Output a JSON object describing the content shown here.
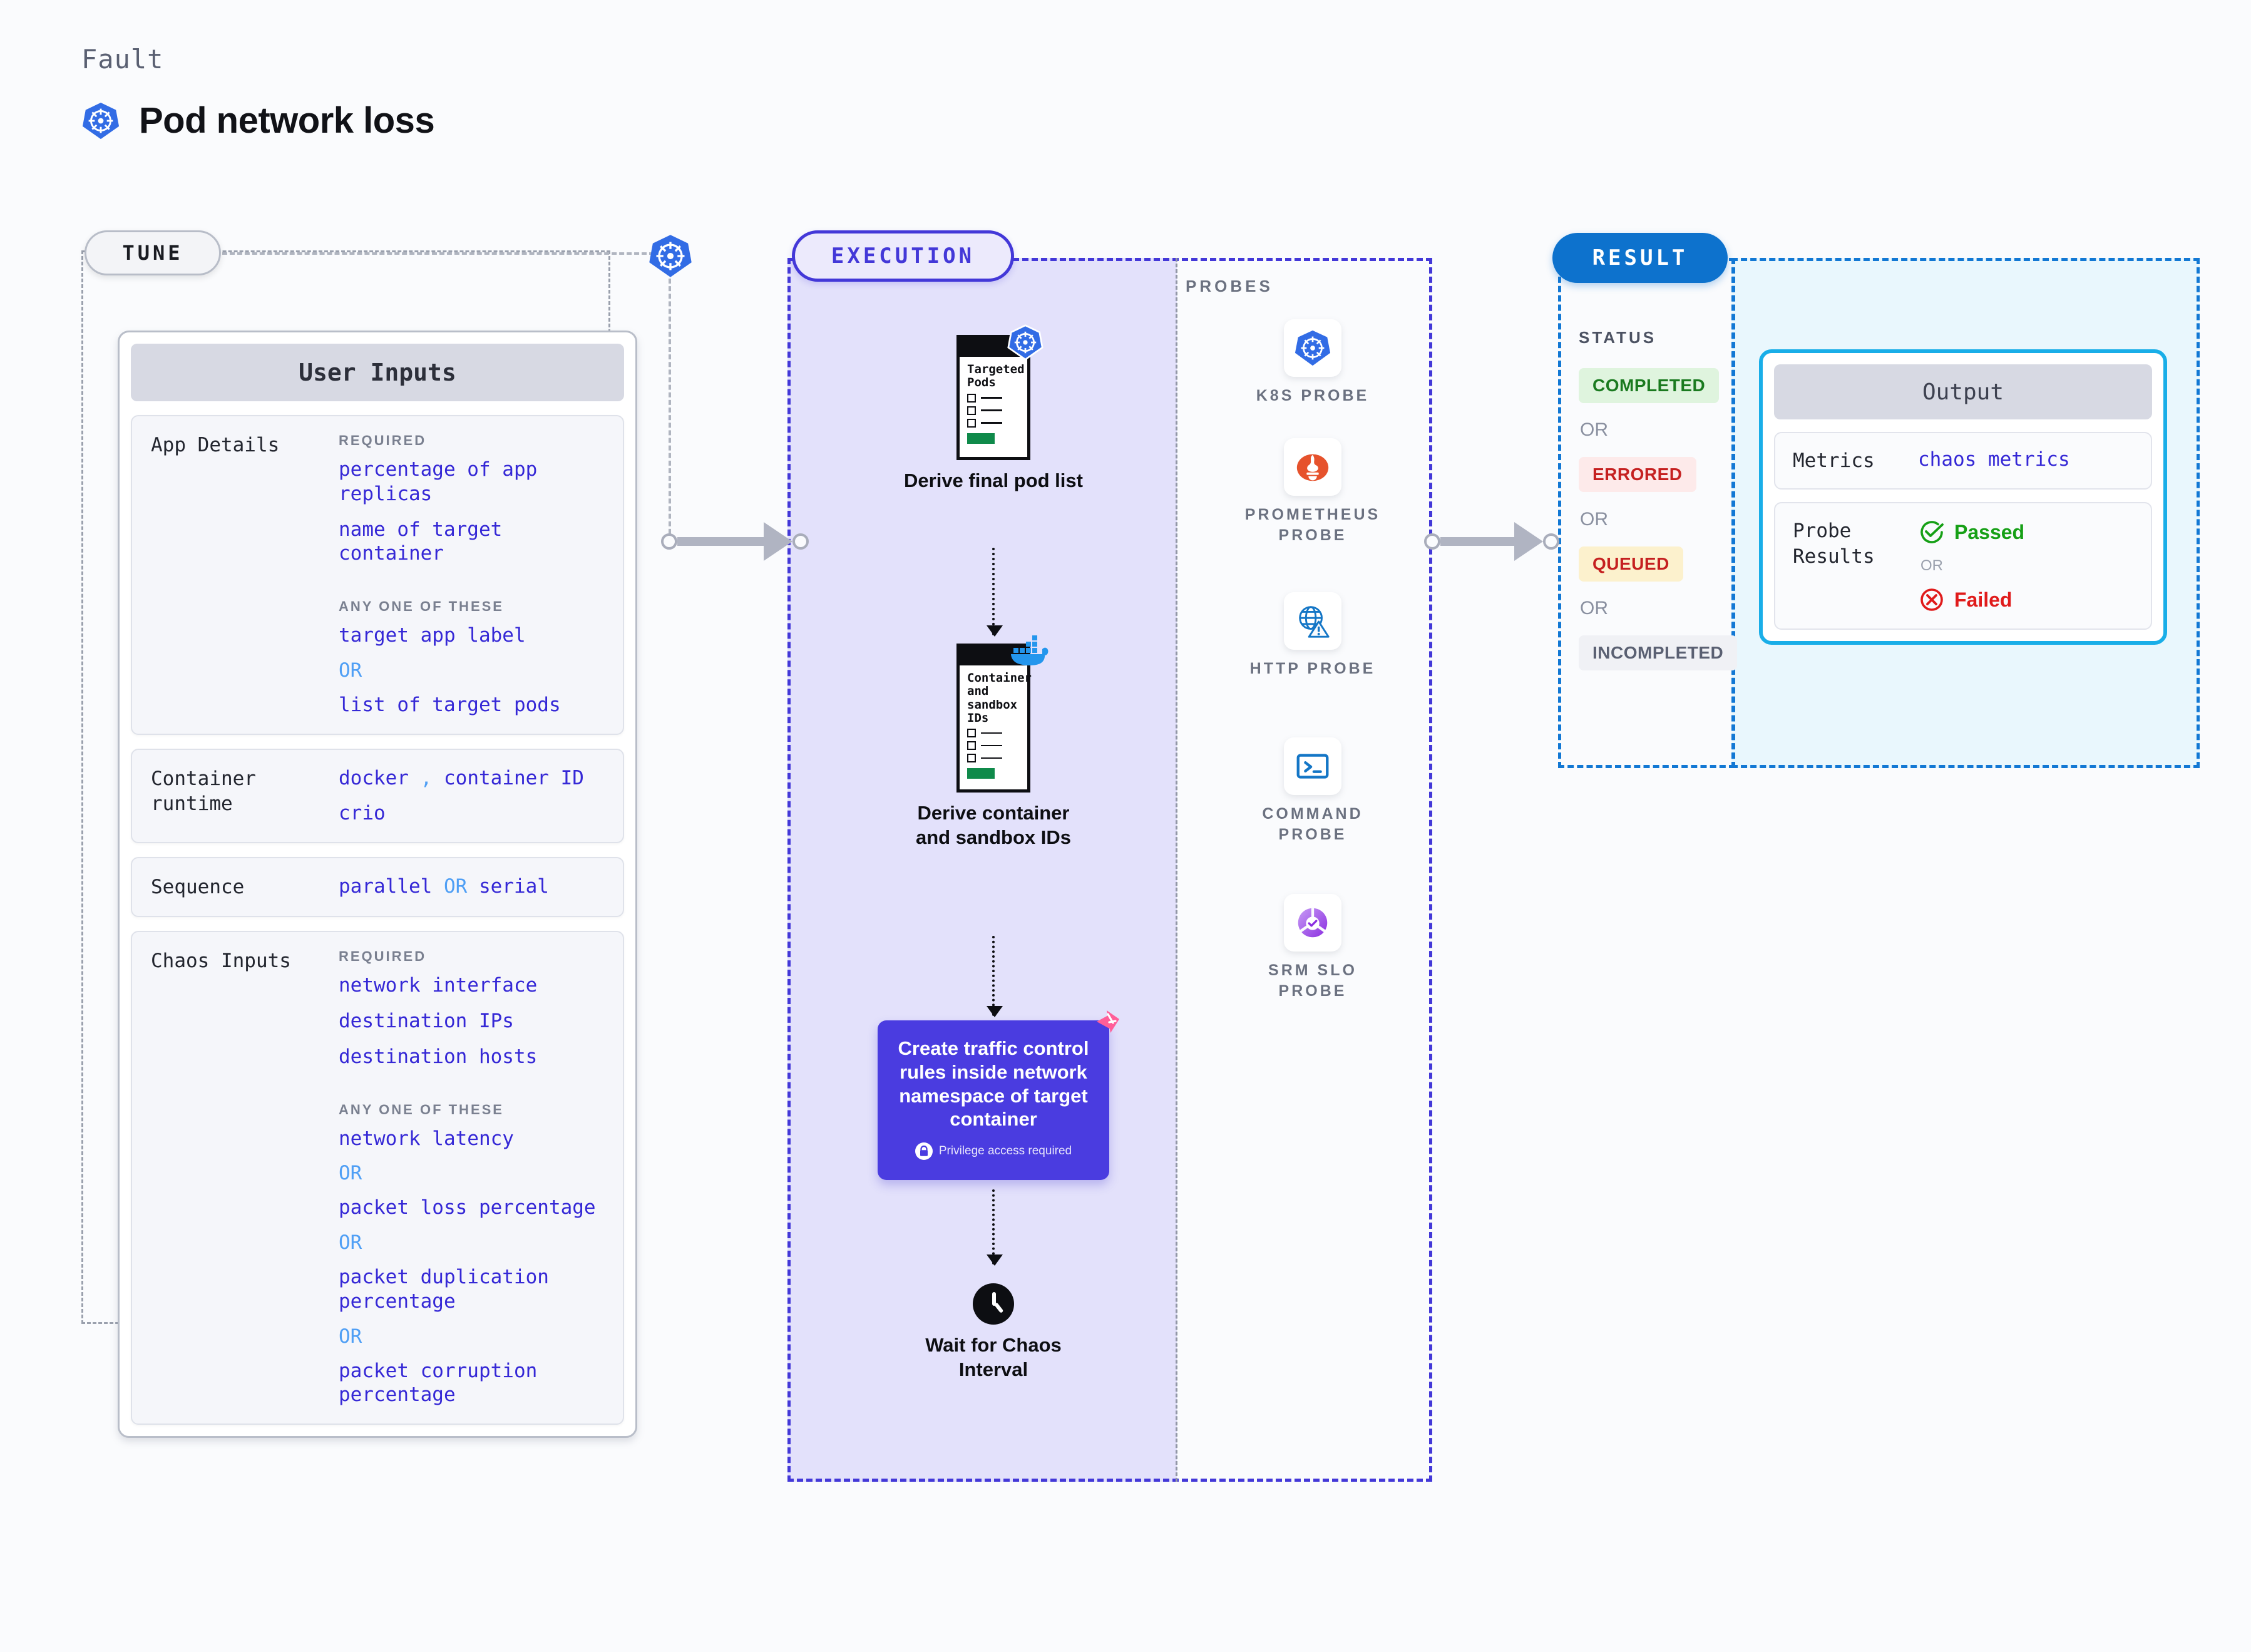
{
  "header": {
    "eyebrow": "Fault",
    "title": "Pod network loss",
    "icon": "kubernetes-icon"
  },
  "tune": {
    "pill_label": "TUNE",
    "card_title": "User Inputs",
    "rows": [
      {
        "label": "App Details",
        "groups": [
          {
            "heading": "REQUIRED",
            "values": [
              "percentage of app replicas",
              "name of target container"
            ]
          },
          {
            "heading": "ANY ONE OF THESE",
            "values": [
              "target app label",
              "OR",
              "list of target pods"
            ]
          }
        ]
      },
      {
        "label": "Container runtime",
        "values_inline": [
          "docker",
          ",",
          "container ID",
          "crio"
        ]
      },
      {
        "label": "Sequence",
        "values_inline": [
          "parallel",
          "OR",
          "serial"
        ]
      },
      {
        "label": "Chaos Inputs",
        "groups": [
          {
            "heading": "REQUIRED",
            "values": [
              "network interface",
              "destination IPs",
              "destination hosts"
            ]
          },
          {
            "heading": "ANY ONE OF THESE",
            "values": [
              "network latency",
              "OR",
              "packet loss percentage",
              "OR",
              "packet duplication percentage",
              "OR",
              "packet corruption percentage"
            ]
          }
        ]
      }
    ]
  },
  "execution": {
    "pill_label": "EXECUTION",
    "steps": [
      {
        "card_title": "Targeted Pods",
        "caption": "Derive final pod list",
        "badge_icon": "kubernetes-icon"
      },
      {
        "card_title": "Container and sandbox IDs",
        "caption": "Derive container and sandbox IDs",
        "badge_icon": "docker-icon"
      }
    ],
    "action": {
      "text": "Create traffic control rules inside network namespace of target container",
      "privilege_note": "Privilege access required",
      "privilege_icon": "lock-icon",
      "badge_icon": "litmus-icon",
      "color": "#4a3ce0"
    },
    "wait": {
      "caption": "Wait for Chaos Interval",
      "icon": "clock-icon"
    }
  },
  "probes": {
    "title": "PROBES",
    "items": [
      {
        "name": "K8S PROBE",
        "icon": "kubernetes-icon"
      },
      {
        "name": "PROMETHEUS PROBE",
        "icon": "prometheus-icon"
      },
      {
        "name": "HTTP PROBE",
        "icon": "http-globe-warning-icon"
      },
      {
        "name": "COMMAND PROBE",
        "icon": "terminal-icon"
      },
      {
        "name": "SRM SLO PROBE",
        "icon": "srm-slo-icon"
      }
    ]
  },
  "result": {
    "pill_label": "RESULT",
    "status_label": "STATUS",
    "or_label": "OR",
    "statuses": [
      {
        "label": "COMPLETED",
        "color": "#1a7a1f",
        "bg": "#dff4de"
      },
      {
        "label": "ERRORED",
        "color": "#c52020",
        "bg": "#fdeaea"
      },
      {
        "label": "QUEUED",
        "color": "#c52020",
        "bg": "#fcf1cd"
      },
      {
        "label": "INCOMPLETED",
        "color": "#5a6072",
        "bg": "#f0f1f5"
      }
    ],
    "output": {
      "title": "Output",
      "metrics_label": "Metrics",
      "metrics_value": "chaos metrics",
      "probe_results_label": "Probe Results",
      "passed_label": "Passed",
      "passed_color": "#16a016",
      "failed_label": "Failed",
      "failed_color": "#e01b1b",
      "or_label": "OR"
    }
  }
}
